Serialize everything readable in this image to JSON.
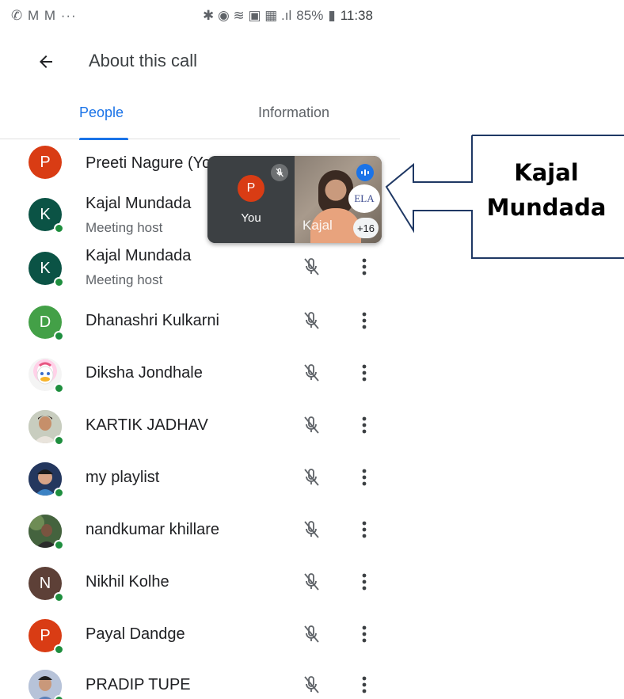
{
  "status_bar": {
    "left_icons": "✆ M M ···",
    "right_icons": "✱ ◉ ≋ ▣ ▦ .ıl",
    "battery": "85%",
    "time": "11:38"
  },
  "app_bar": {
    "title": "About this call",
    "back_icon": "arrow-back-icon"
  },
  "tabs": [
    {
      "label": "People",
      "active": true
    },
    {
      "label": "Information",
      "active": false
    }
  ],
  "participants": [
    {
      "initial": "P",
      "name": "Preeti Nagure (You)",
      "role": "",
      "color": "#d93c14",
      "online": false
    },
    {
      "initial": "K",
      "name": "Kajal Mundada",
      "role": "Meeting host",
      "color": "#0b5345",
      "online": true
    },
    {
      "initial": "K",
      "name": "Kajal Mundada",
      "role": "Meeting host",
      "color": "#0b5345",
      "online": true
    },
    {
      "initial": "D",
      "name": "Dhanashri Kulkarni",
      "role": "",
      "color": "#43a047",
      "online": true
    },
    {
      "initial": "",
      "name": "Diksha Jondhale",
      "role": "",
      "color": "#ffffff",
      "online": true,
      "photo": "daisy"
    },
    {
      "initial": "",
      "name": "KARTIK JADHAV",
      "role": "",
      "color": "#ffffff",
      "online": true,
      "photo": "man"
    },
    {
      "initial": "",
      "name": "my playlist",
      "role": "",
      "color": "#ffffff",
      "online": true,
      "photo": "child"
    },
    {
      "initial": "",
      "name": "nandkumar khillare",
      "role": "",
      "color": "#ffffff",
      "online": true,
      "photo": "outdoor"
    },
    {
      "initial": "N",
      "name": "Nikhil Kolhe",
      "role": "",
      "color": "#5d4037",
      "online": true
    },
    {
      "initial": "P",
      "name": "Payal Dandge",
      "role": "",
      "color": "#d93c14",
      "online": true
    },
    {
      "initial": "",
      "name": "PRADIP TUPE",
      "role": "",
      "color": "#ffffff",
      "online": true,
      "photo": "boy"
    }
  ],
  "pip": {
    "self_label": "You",
    "self_initial": "P",
    "video_name": "Kajal",
    "more_count": "+16",
    "logo_text": "ELA"
  },
  "callout": {
    "line1": "Kajal",
    "line2": "Mundada"
  }
}
